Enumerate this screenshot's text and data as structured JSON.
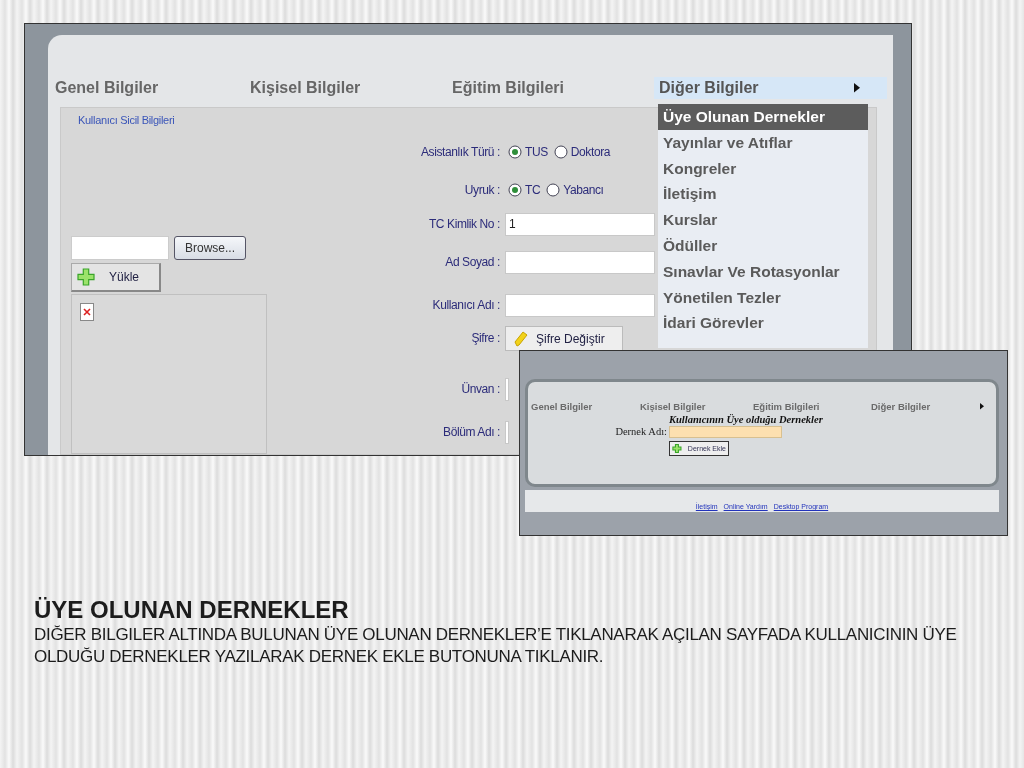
{
  "screenshot_1": {
    "tabs": [
      {
        "label": "Genel Bilgiler",
        "selected": false
      },
      {
        "label": "Kişisel Bilgiler",
        "selected": false
      },
      {
        "label": "Eğitim Bilgileri",
        "selected": false
      },
      {
        "label": "Diğer Bilgiler",
        "selected": true,
        "submenu": true
      }
    ],
    "menu": [
      {
        "label": "Üye Olunan Dernekler",
        "selected": true
      },
      {
        "label": "Yayınlar ve Atıflar",
        "selected": false
      },
      {
        "label": "Kongreler",
        "selected": false
      },
      {
        "label": "İletişim",
        "selected": false
      },
      {
        "label": "Kurslar",
        "selected": false
      },
      {
        "label": "Ödüller",
        "selected": false
      },
      {
        "label": "Sınavlar Ve Rotasyonlar",
        "selected": false
      },
      {
        "label": "Yönetilen Tezler",
        "selected": false
      },
      {
        "label": "İdari Görevler",
        "selected": false
      }
    ],
    "legend": "Kullanıcı Sicil Bilgileri",
    "photo": {
      "browse_button": "Browse...",
      "upload_button": "Yükle"
    },
    "form": [
      {
        "kind": "radio",
        "label": "Asistanlık Türü :",
        "options": [
          {
            "label": "TUS",
            "selected": true
          },
          {
            "label": "Doktora",
            "selected": false
          }
        ]
      },
      {
        "kind": "radio",
        "label": "Uyruk :",
        "options": [
          {
            "label": "TC",
            "selected": true
          },
          {
            "label": "Yabancı",
            "selected": false
          }
        ]
      },
      {
        "kind": "text",
        "label": "TC Kimlik No :",
        "value": "1"
      },
      {
        "kind": "text",
        "label": "Ad Soyad :"
      },
      {
        "kind": "text",
        "label": "Kullanıcı Adı :"
      },
      {
        "kind": "button",
        "label": "Şifre :",
        "button": "Şifre Değiştir"
      },
      {
        "kind": "text",
        "label": "Ünvan :"
      },
      {
        "kind": "text",
        "label": "Bölüm Adı :"
      }
    ]
  },
  "screenshot_2": {
    "tabs": [
      {
        "label": "Genel Bilgiler",
        "selected": false
      },
      {
        "label": "Kişisel Bilgiler",
        "selected": false
      },
      {
        "label": "Eğitim Bilgileri",
        "selected": false
      },
      {
        "label": "Diğer Bilgiler",
        "selected": false,
        "submenu": true
      }
    ],
    "heading": "Kullanıcının Üye olduğu Dernekler",
    "field_label": "Dernek Adı:",
    "add_button": "Dernek Ekle",
    "footer_links": [
      "İletişim",
      "Online Yardım",
      "Desktop Program"
    ]
  },
  "slide": {
    "title": "ÜYE OLUNAN DERNEKLER",
    "body": "DIĞER BILGILER ALTINDA BULUNAN ÜYE OLUNAN DERNEKLER’E TIKLANARAK AÇILAN SAYFADA KULLANICININ ÜYE OLDUĞU DERNEKLER YAZILARAK DERNEK EKLE BUTONUNA TIKLANIR."
  }
}
